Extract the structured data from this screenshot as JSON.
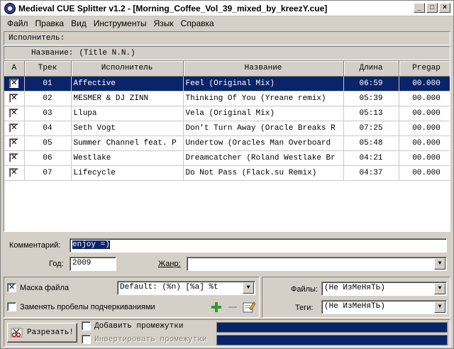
{
  "window": {
    "title": "Medieval CUE Splitter v1.2 - [Morning_Coffee_Vol_39_mixed_by_kreezY.cue]"
  },
  "title_buttons": {
    "minimize": "_",
    "maximize": "□",
    "close": "×"
  },
  "menu": [
    "Файл",
    "Правка",
    "Вид",
    "Инструменты",
    "Язык",
    "Справка"
  ],
  "info": {
    "artist_label": "Исполнитель:",
    "artist_value": "",
    "title_label": "Название:",
    "title_value": "(Title N.N.)"
  },
  "table": {
    "columns": [
      "A",
      "Трек",
      "Исполнитель",
      "Название",
      "Длина",
      "Pregap"
    ],
    "rows": [
      {
        "checked": true,
        "track": "01",
        "artist": "Affective",
        "title": "Feel (Original Mix)",
        "length": "06:59",
        "pregap": "00.000",
        "selected": true
      },
      {
        "checked": true,
        "track": "02",
        "artist": "MESMER & DJ ZINN",
        "title": "Thinking Of You (Yreane remix)",
        "length": "05:39",
        "pregap": "00.000",
        "selected": false
      },
      {
        "checked": true,
        "track": "03",
        "artist": "Llupa",
        "title": "Vela (Original Mix)",
        "length": "05:13",
        "pregap": "00.000",
        "selected": false
      },
      {
        "checked": true,
        "track": "04",
        "artist": "Seth Vogt",
        "title": "Don't Turn Away (Oracle Breaks R",
        "length": "07:25",
        "pregap": "00.000",
        "selected": false
      },
      {
        "checked": true,
        "track": "05",
        "artist": "Summer Channel feat. P",
        "title": "Undertow (Oracles Man Overboard",
        "length": "05:48",
        "pregap": "00.000",
        "selected": false
      },
      {
        "checked": true,
        "track": "06",
        "artist": "Westlake",
        "title": "Dreamcatcher (Roland Westlake Br",
        "length": "04:21",
        "pregap": "00.000",
        "selected": false
      },
      {
        "checked": true,
        "track": "07",
        "artist": "Lifecycle",
        "title": "Do Not Pass (Flack.su Remix)",
        "length": "04:37",
        "pregap": "00.000",
        "selected": false
      }
    ]
  },
  "comment": {
    "label": "Комментарий:",
    "value": "enjoy =)"
  },
  "year": {
    "label": "Год:",
    "value": "2009"
  },
  "genre": {
    "label": "Жанр:",
    "value": ""
  },
  "options": {
    "file_mask_label": "Маска файла",
    "file_mask_checked": true,
    "file_mask_value": "Default: (%n) [%a] %t",
    "replace_spaces_label": "Заменять пробелы подчеркиваниями",
    "replace_spaces_checked": false
  },
  "case": {
    "files_label": "Файлы:",
    "files_value": "(Не ИзМеНяТЬ)",
    "tags_label": "Теги:",
    "tags_value": "(Не ИзМеНяТЬ)"
  },
  "actions": {
    "split_label": "Разрезать!",
    "add_gaps_label": "Добавить промежутки",
    "invert_gaps_label": "Инвертировать промежутки",
    "add_gaps_checked": false,
    "invert_gaps_checked": false
  },
  "icons": {
    "add": "plus-icon",
    "remove": "minus-icon",
    "edit": "edit-icon",
    "split": "scissors-icon"
  },
  "colors": {
    "selection": "#0a246a",
    "face": "#d4d0c8",
    "add_icon": "#2e9d2e"
  }
}
